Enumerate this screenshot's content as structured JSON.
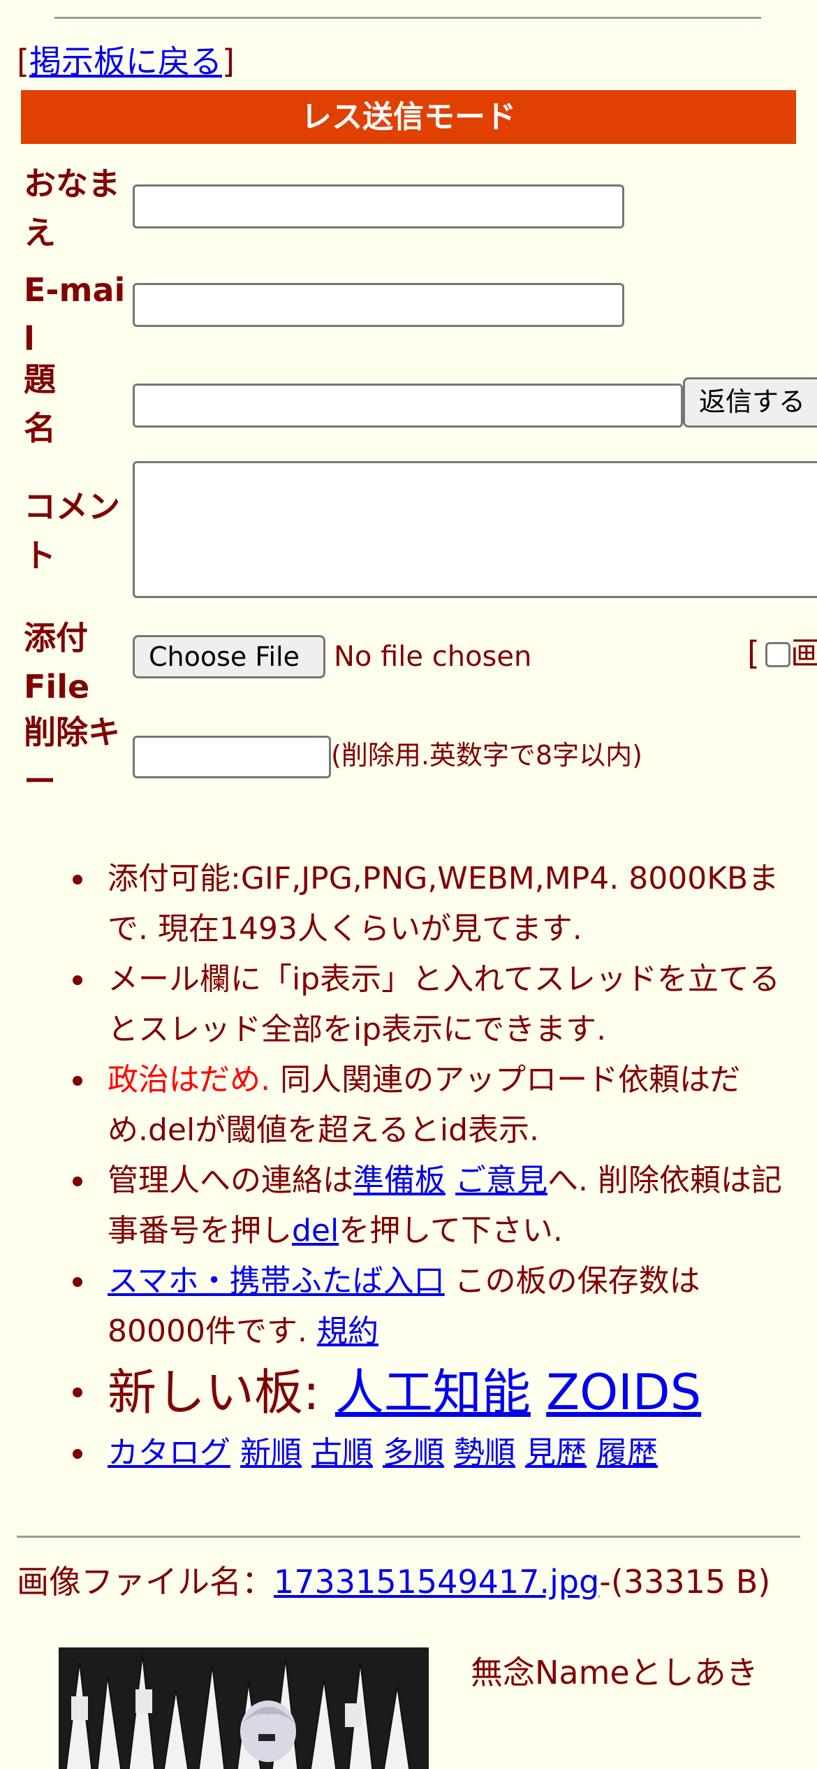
{
  "nav": {
    "back_bracket_open": "[",
    "back_label": "掲示板に戻る",
    "back_bracket_close": "]"
  },
  "form": {
    "title": "レス送信モード",
    "name_label": "おなまえ",
    "email_label": "E-mail",
    "subject_label": "題名",
    "submit_label": "返信する",
    "comment_label": "コメント",
    "file_label": "添付File",
    "choose_file_label": "Choose File",
    "no_file_text": "No file chosen",
    "image_option_bracket": "[",
    "image_option_partial": "画",
    "delete_key_label": "削除キー",
    "delete_key_hint": "(削除用.英数字で8字以内)"
  },
  "rules": {
    "item1": "添付可能:GIF,JPG,PNG,WEBM,MP4. 8000KBまで. 現在1493人くらいが見てます.",
    "item2": "メール欄に「ip表示」と入れてスレッドを立てるとスレッド全部をip表示にできます.",
    "item3_red": "政治はだめ.",
    "item3_rest": " 同人関連のアップロード依頼はだめ.delが閾値を超えるとid表示.",
    "item4_pre": "管理人への連絡は",
    "item4_link1": "準備板",
    "item4_link2": "ご意見",
    "item4_mid": "へ. 削除依頼は記事番号を押し",
    "item4_link3": "del",
    "item4_post": "を押して下さい.",
    "item5_link": "スマホ・携帯ふたば入口",
    "item5_mid": " この板の保存数は80000件です. ",
    "item5_link2": "規約",
    "item6_text": "新しい板: ",
    "item6_link1": "人工知能",
    "item6_link2": "ZOIDS",
    "links": [
      "カタログ",
      "新順",
      "古順",
      "多順",
      "勢順",
      "見歴",
      "履歴"
    ]
  },
  "post": {
    "file_label": "画像ファイル名：",
    "file_name": "1733151549417.jpg",
    "file_size": "-(33315 B)",
    "name_line": "無念Nameとしあき"
  }
}
